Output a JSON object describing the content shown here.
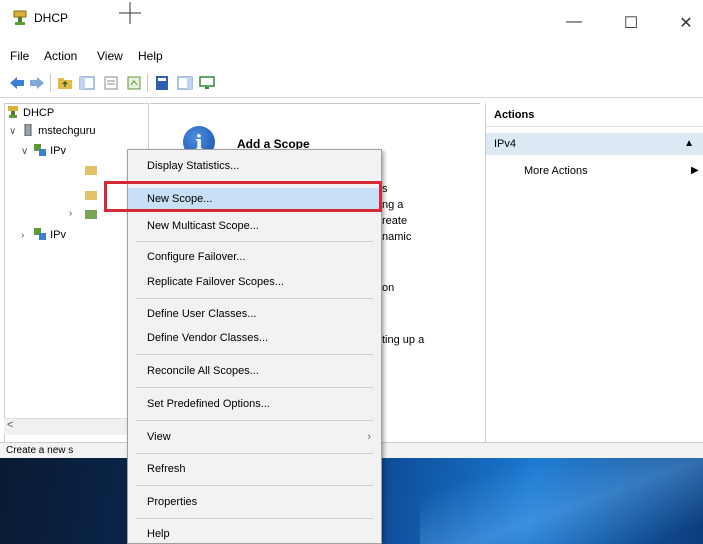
{
  "window": {
    "title": "DHCP"
  },
  "menu": {
    "file": "File",
    "action": "Action",
    "view": "View",
    "help": "Help"
  },
  "tree": {
    "root": "DHCP",
    "server": "mstechguru",
    "ipv4_label": "IPv",
    "ipv6_label": "IPv"
  },
  "center": {
    "heading": "Add a Scope",
    "fragments": [
      "s",
      "ng a",
      "reate",
      "namic",
      "on",
      "ting up a"
    ]
  },
  "actions": {
    "header": "Actions",
    "section": "IPv4",
    "more": "More Actions"
  },
  "status": {
    "text": "Create a new s"
  },
  "context_menu": {
    "items": [
      "Display Statistics...",
      "New Scope...",
      "New Multicast Scope...",
      "Configure Failover...",
      "Replicate Failover Scopes...",
      "Define User Classes...",
      "Define Vendor Classes...",
      "Reconcile All Scopes...",
      "Set Predefined Options...",
      "View",
      "Refresh",
      "Properties",
      "Help"
    ]
  },
  "colors": {
    "highlight_border": "#d42a35",
    "selection": "#c7dff7",
    "actions_section_bg": "#dde8f5"
  }
}
